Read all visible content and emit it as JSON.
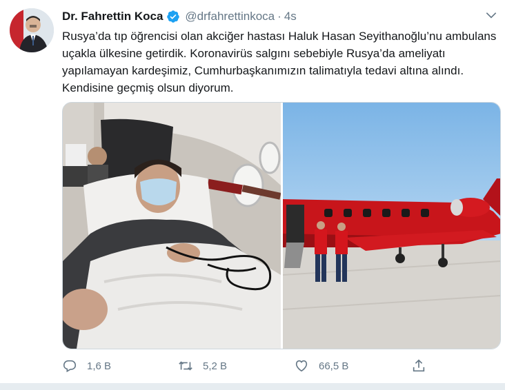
{
  "tweet": {
    "author_name": "Dr. Fahrettin Koca",
    "author_handle": "@drfahrettinkoca",
    "separator": "·",
    "time": "4s",
    "text": "Rusya’da tıp öğrencisi olan akciğer hastası Haluk Hasan Seyithanoğlu’nu ambulans uçakla ülkesine getirdik. Koronavirüs salgını sebebiyle Rusya’da ameliyatı yapılamayan kardeşimiz, Cumhurbaşkanımızın talimatıyla tedavi altına alındı. Kendisine geçmiş olsun diyorum.",
    "actions": {
      "reply_count": "1,6 B",
      "retweet_count": "5,2 B",
      "like_count": "66,5 B"
    },
    "icons": {
      "verified": "verified-badge-icon",
      "caret": "chevron-down-icon",
      "reply": "reply-icon",
      "retweet": "retweet-icon",
      "like": "heart-icon",
      "share": "share-icon"
    },
    "colors": {
      "accent": "#1da1f2",
      "muted": "#657786",
      "text": "#14171a",
      "plane_red": "#c8151b"
    }
  }
}
